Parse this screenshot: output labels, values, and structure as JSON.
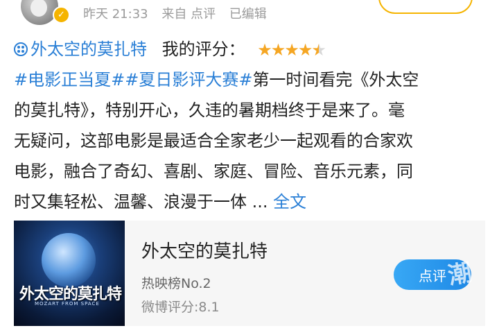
{
  "post": {
    "time": "昨天 21:33",
    "source": "来自 点评",
    "edited": "已编辑"
  },
  "review": {
    "movie_tag": "外太空的莫扎特",
    "rating_label": "我的评分：",
    "rating": 4.5,
    "rating_max": 5,
    "topic1": "#电影正当夏#",
    "topic2": "#夏日影评大赛#",
    "line1_text": "第一时间看完《外太空",
    "line2": "的莫扎特》，特别开心，久违的暑期档终于是来了。毫",
    "line3": "无疑问，这部电影是最适合全家老少一起观看的合家欢",
    "line4": "电影，融合了奇幻、喜剧、家庭、冒险、音乐元素，同",
    "line5_text": "时又集轻松、温馨、浪漫于一体 ... ",
    "full_text_link": "全文"
  },
  "card": {
    "poster_title": "外太空的莫扎特",
    "poster_subtitle": "MOZART FROM SPACE",
    "title": "外太空的莫扎特",
    "rank": "热映榜No.2",
    "score": "微博评分:8.1",
    "review_button": "点评"
  },
  "colors": {
    "link_blue": "#2a7fd6",
    "star_orange": "#f5a623",
    "verified_gold": "#f5b400"
  },
  "icons": {
    "movie_tag": "film-reel-icon",
    "verified": "verified-badge-icon",
    "rating": "star-icon"
  }
}
